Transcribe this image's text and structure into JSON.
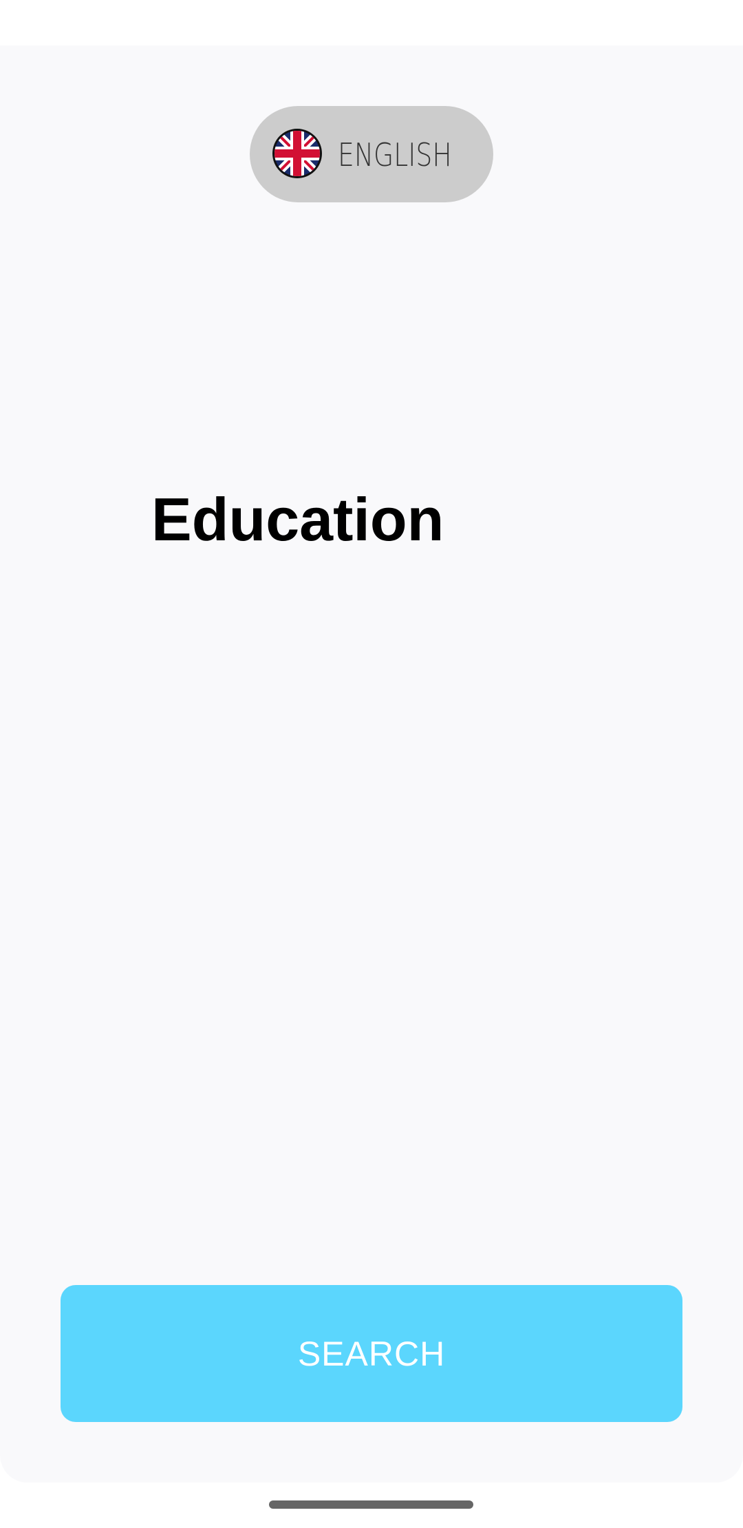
{
  "language_selector": {
    "label": "ENGLISH",
    "icon": "uk-flag-icon"
  },
  "page": {
    "title": "Education"
  },
  "search_button": {
    "label": "SEARCH"
  },
  "colors": {
    "accent": "#5bd6fd",
    "pill_background": "#cccccc",
    "surface": "#f9f9fb"
  }
}
